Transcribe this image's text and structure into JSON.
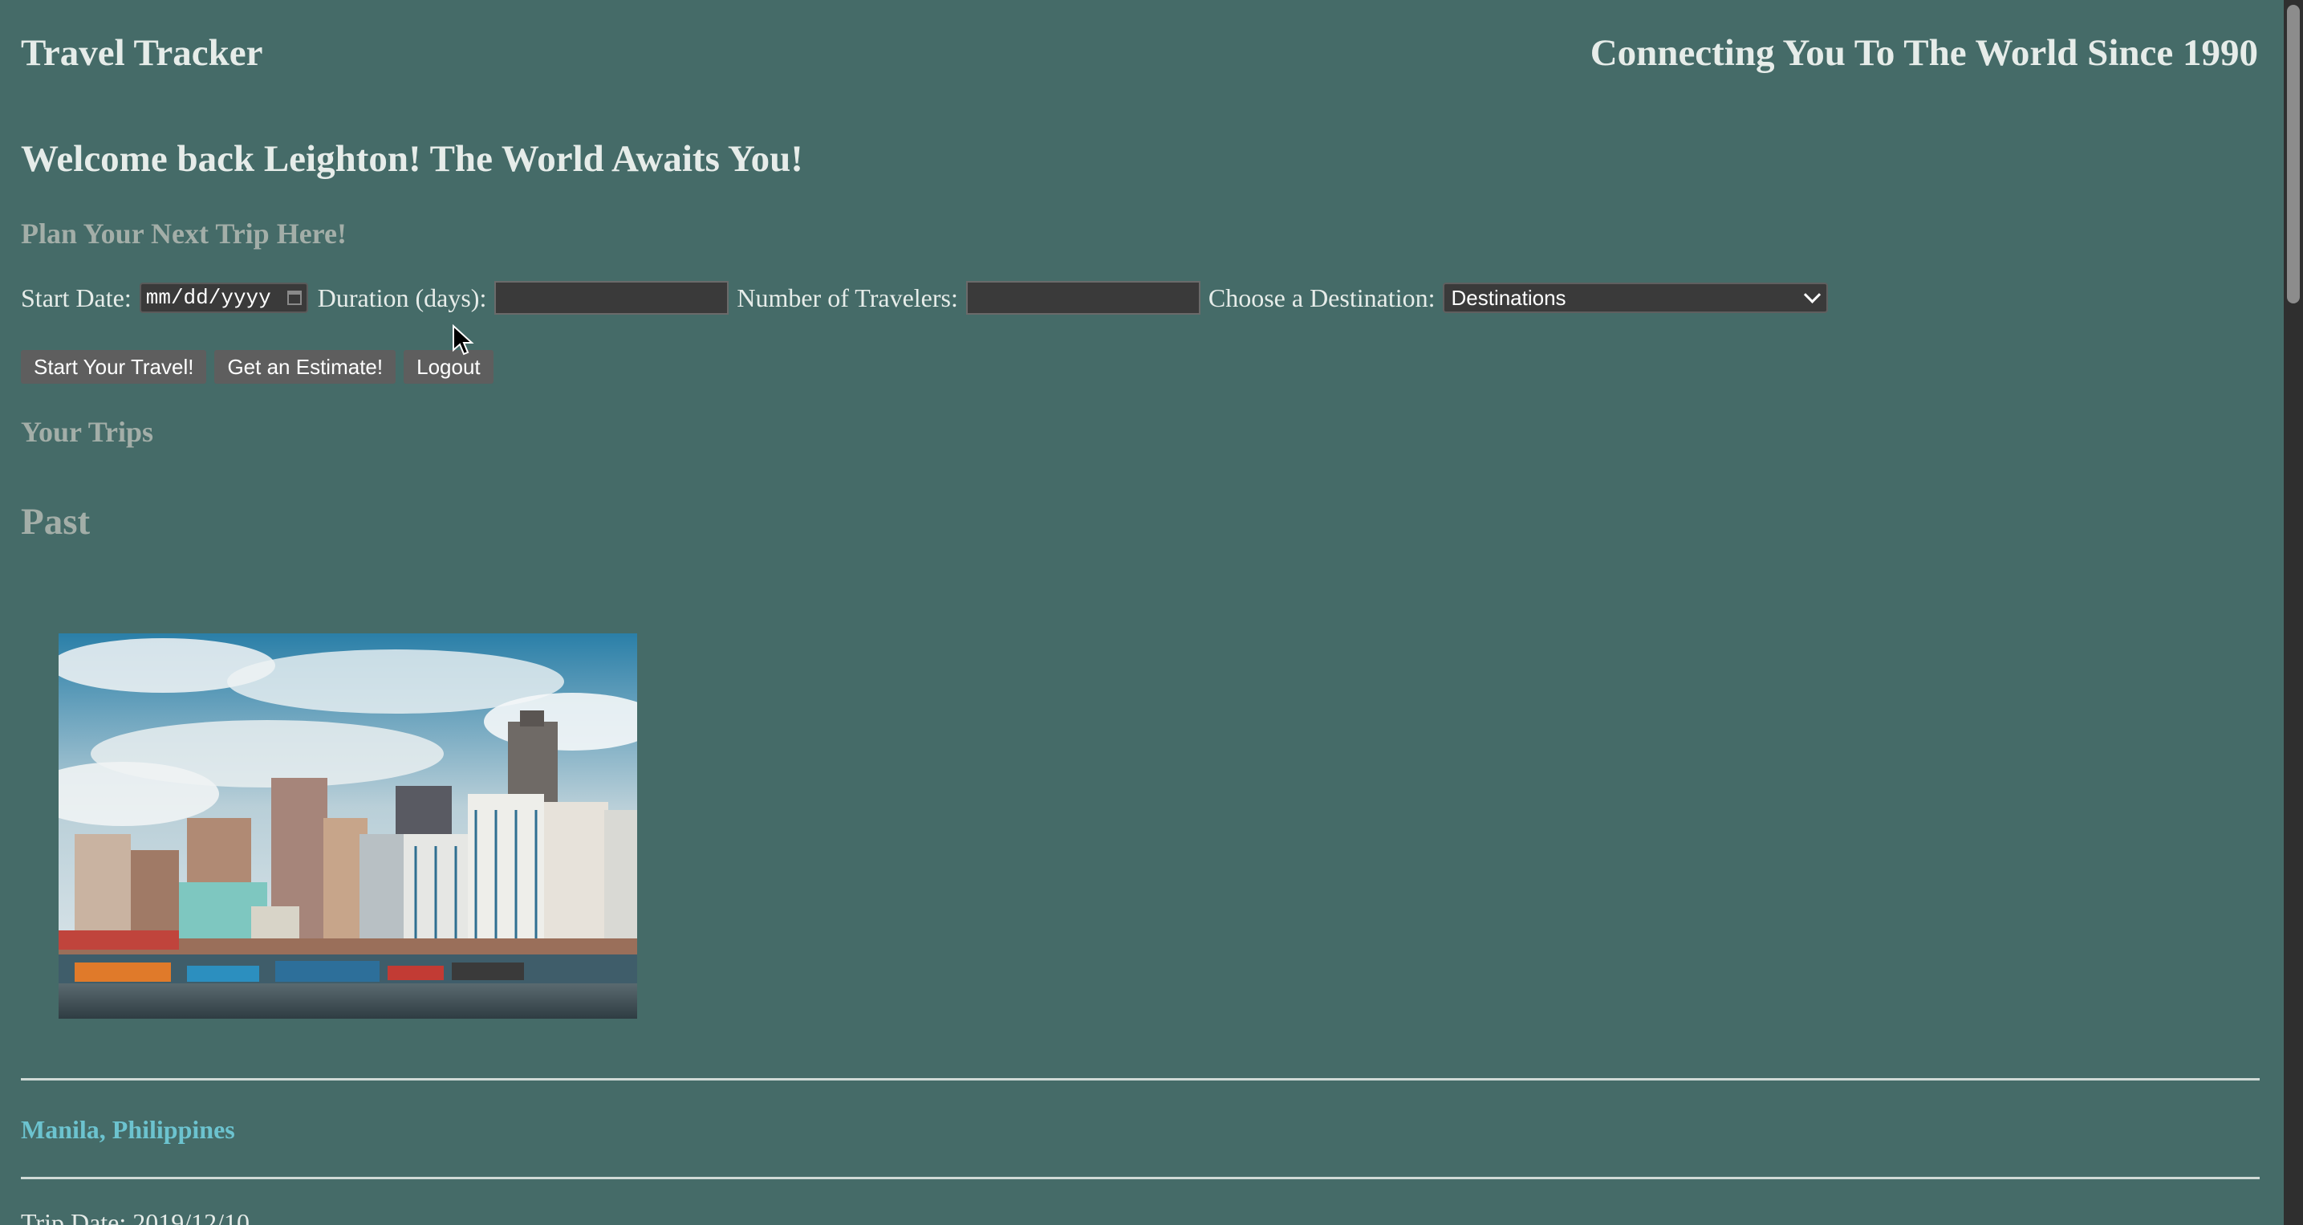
{
  "header": {
    "brand": "Travel Tracker",
    "tagline": "Connecting You To The World Since 1990"
  },
  "welcome": "Welcome back Leighton! The World Awaits You!",
  "plan": {
    "heading": "Plan Your Next Trip Here!",
    "start_date_label": "Start Date:",
    "start_date_placeholder": "mm/dd/yyyy",
    "duration_label": "Duration (days):",
    "duration_value": "",
    "travelers_label": "Number of Travelers:",
    "travelers_value": "",
    "destination_label": "Choose a Destination:",
    "destination_selected": "Destinations"
  },
  "buttons": {
    "start_travel": "Start Your Travel!",
    "estimate": "Get an Estimate!",
    "logout": "Logout"
  },
  "trips": {
    "heading": "Your Trips",
    "past_heading": "Past",
    "items": [
      {
        "destination": "Manila, Philippines",
        "date": "Trip Date: 2019/12/10",
        "image_icon": "manila-city-photo"
      }
    ]
  },
  "colors": {
    "background": "#456b68",
    "heading_muted": "#a3aea8",
    "destination_link": "#6cc3cf",
    "button_bg": "#5e5e5e"
  }
}
